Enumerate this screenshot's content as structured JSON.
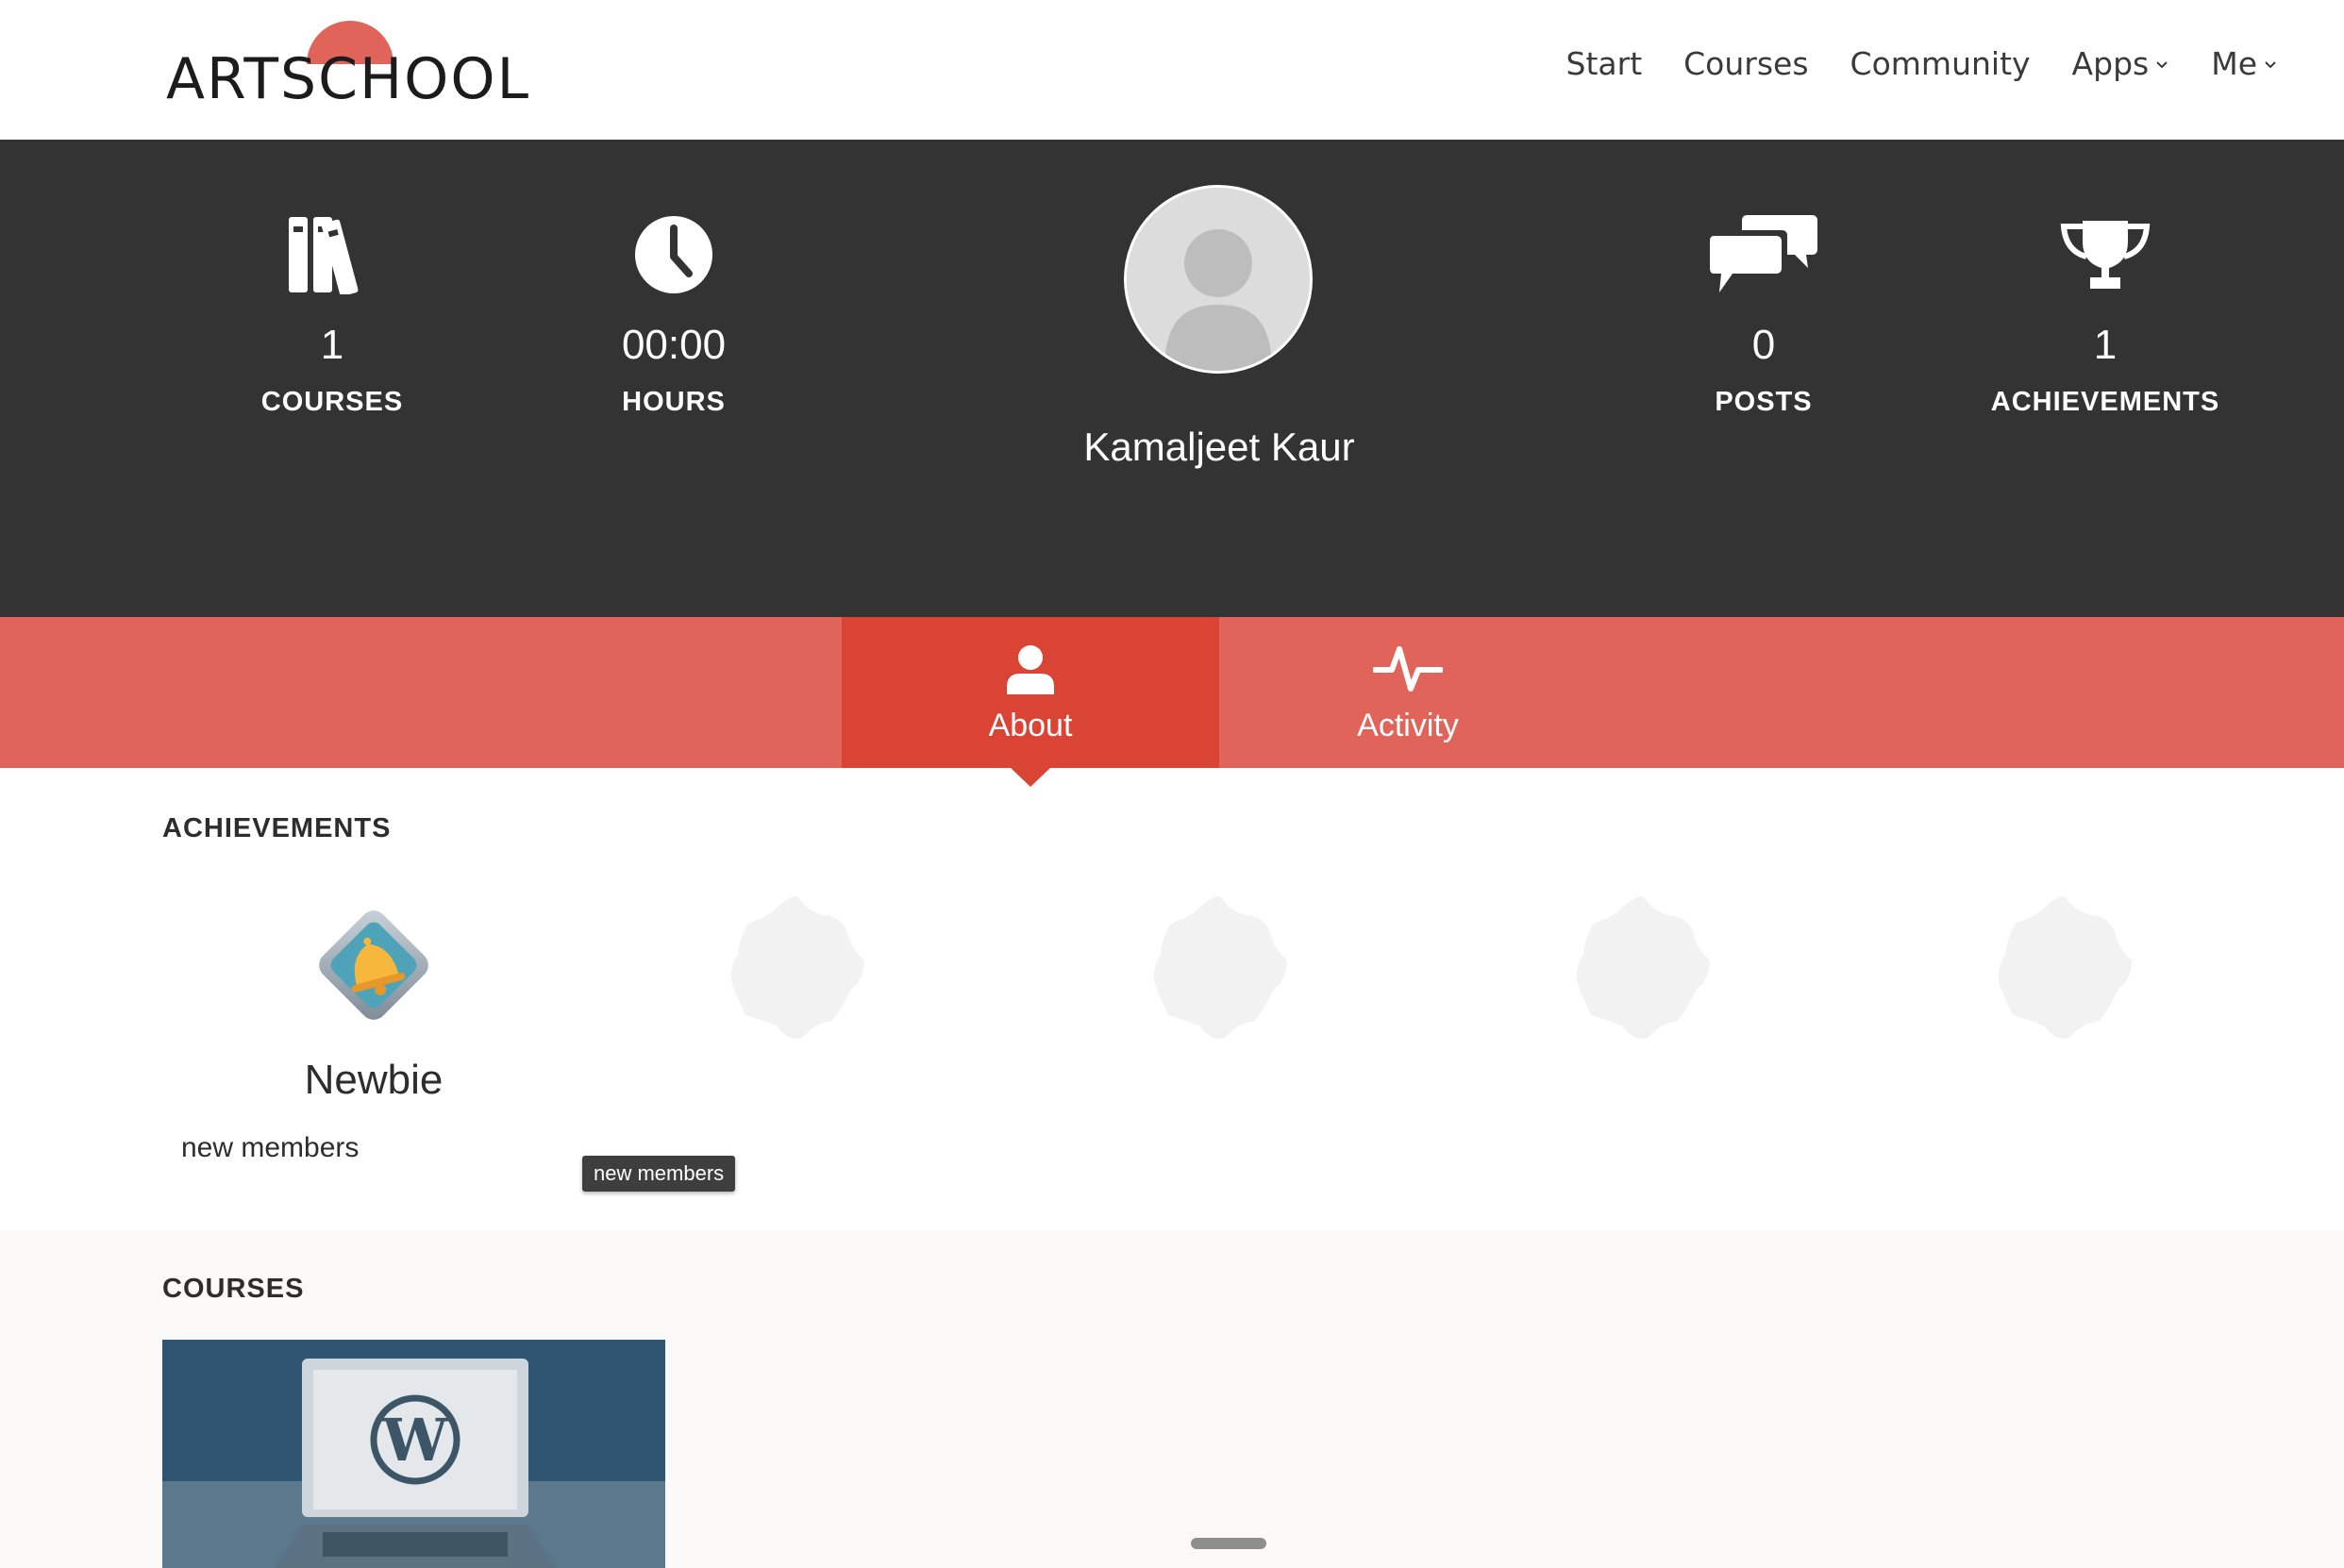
{
  "header": {
    "logo_text": "ARTSCHOOL",
    "nav": [
      {
        "label": "Start",
        "has_dropdown": false
      },
      {
        "label": "Courses",
        "has_dropdown": false
      },
      {
        "label": "Community",
        "has_dropdown": false
      },
      {
        "label": "Apps",
        "has_dropdown": true
      },
      {
        "label": "Me",
        "has_dropdown": true
      }
    ]
  },
  "profile": {
    "name": "Kamaljeet Kaur",
    "stats": {
      "courses": {
        "value": "1",
        "label": "COURSES",
        "icon": "books-icon"
      },
      "hours": {
        "value": "00:00",
        "label": "HOURS",
        "icon": "clock-icon"
      },
      "posts": {
        "value": "0",
        "label": "POSTS",
        "icon": "chat-bubbles-icon"
      },
      "achievements": {
        "value": "1",
        "label": "ACHIEVEMENTS",
        "icon": "trophy-icon"
      }
    }
  },
  "tabs": [
    {
      "label": "About",
      "icon": "user-icon",
      "active": true
    },
    {
      "label": "Activity",
      "icon": "pulse-icon",
      "active": false
    }
  ],
  "achievements_section": {
    "title": "ACHIEVEMENTS",
    "earned": {
      "name": "Newbie",
      "description": "new members",
      "icon": "bell-badge-icon"
    },
    "tooltip": "new members",
    "locked_slots": 4
  },
  "courses_section": {
    "title": "COURSES",
    "card_icon": "wordpress-laptop-icon"
  },
  "colors": {
    "brand_red": "#e0645a",
    "active_tab": "#d94434",
    "dark_band": "#333333"
  }
}
